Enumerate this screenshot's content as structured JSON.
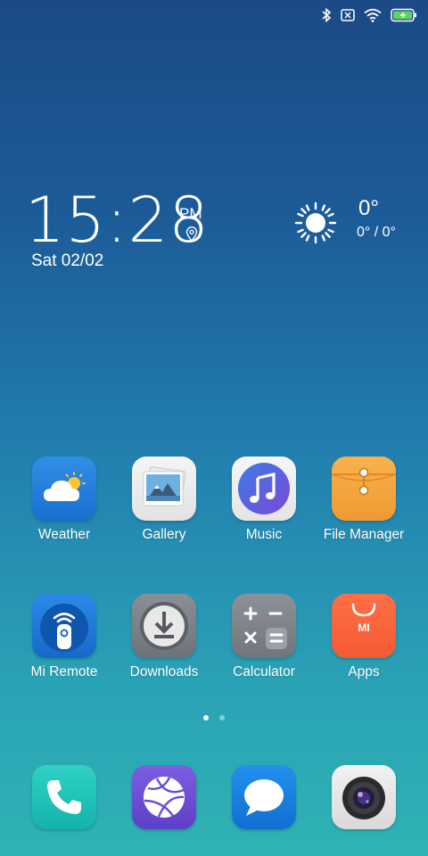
{
  "status_bar": {
    "icons": [
      "bluetooth-icon",
      "no-sim-icon",
      "wifi-icon",
      "battery-charging-icon"
    ]
  },
  "clock": {
    "time": "15:28",
    "ampm": "PM",
    "date": "Sat 02/02"
  },
  "weather": {
    "temperature": "0°",
    "range": "0° / 0°",
    "icon": "sun-icon"
  },
  "apps_row1": [
    {
      "label": "Weather",
      "icon": "weather-app-icon"
    },
    {
      "label": "Gallery",
      "icon": "gallery-app-icon"
    },
    {
      "label": "Music",
      "icon": "music-app-icon"
    },
    {
      "label": "File Manager",
      "icon": "file-manager-app-icon"
    }
  ],
  "apps_row2": [
    {
      "label": "Mi Remote",
      "icon": "mi-remote-app-icon"
    },
    {
      "label": "Downloads",
      "icon": "downloads-app-icon"
    },
    {
      "label": "Calculator",
      "icon": "calculator-app-icon"
    },
    {
      "label": "Apps",
      "icon": "apps-store-icon"
    }
  ],
  "apps_store_text": "MI",
  "page_indicator": {
    "pages": 2,
    "current": 1
  },
  "dock": [
    {
      "icon": "phone-app-icon"
    },
    {
      "icon": "browser-app-icon"
    },
    {
      "icon": "messaging-app-icon"
    },
    {
      "icon": "camera-app-icon"
    }
  ]
}
